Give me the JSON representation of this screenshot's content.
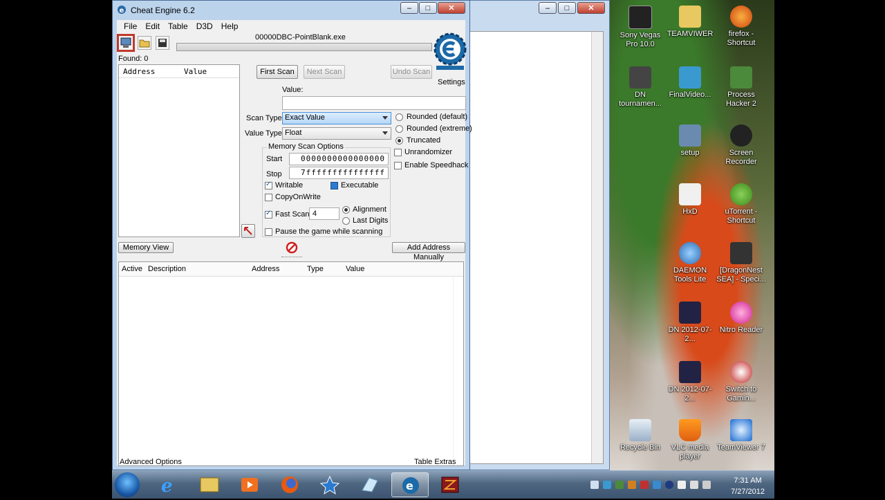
{
  "window": {
    "title": "Cheat Engine 6.2",
    "controls": {
      "minimize": "–",
      "maximize": "□",
      "close": "✕"
    }
  },
  "menu": [
    "File",
    "Edit",
    "Table",
    "D3D",
    "Help"
  ],
  "process": "00000DBC-PointBlank.exe",
  "found": "Found: 0",
  "settings": "Settings",
  "address_list": {
    "columns": [
      "Address",
      "Value"
    ]
  },
  "scan": {
    "first_scan": "First Scan",
    "next_scan": "Next Scan",
    "undo_scan": "Undo Scan",
    "value_label": "Value:",
    "value": "",
    "scan_type_label": "Scan Type",
    "scan_type": "Exact Value",
    "value_type_label": "Value Type",
    "value_type": "Float"
  },
  "rounding": {
    "rounded_default": "Rounded (default)",
    "rounded_extreme": "Rounded (extreme)",
    "truncated": "Truncated",
    "selected": "truncated"
  },
  "options": {
    "unrandomizer": "Unrandomizer",
    "enable_speedhack": "Enable Speedhack"
  },
  "memory_scan": {
    "title": "Memory Scan Options",
    "start_label": "Start",
    "start": "0000000000000000",
    "stop_label": "Stop",
    "stop": "7fffffffffffffff",
    "writable": "Writable",
    "executable": "Executable",
    "copy_on_write": "CopyOnWrite",
    "fast_scan": "Fast Scan",
    "fast_scan_value": "4",
    "alignment": "Alignment",
    "last_digits": "Last Digits",
    "pause": "Pause the game while scanning"
  },
  "buttons": {
    "memory_view": "Memory View",
    "add_address": "Add Address Manually"
  },
  "cheat_table": {
    "columns": [
      "Active",
      "Description",
      "Address",
      "Type",
      "Value"
    ]
  },
  "footer": {
    "advanced": "Advanced Options",
    "extras": "Table Extras"
  },
  "desktop_icons": [
    {
      "label": "Sony Vegas Pro 10.0"
    },
    {
      "label": "TEAMVIWER"
    },
    {
      "label": "firefox - Shortcut"
    },
    {
      "label": "DN tournamen..."
    },
    {
      "label": "FinalVideo..."
    },
    {
      "label": "Process Hacker 2"
    },
    {
      "label": "setup"
    },
    {
      "label": "Screen Recorder"
    },
    {
      "label": "HxD"
    },
    {
      "label": "uTorrent - Shortcut"
    },
    {
      "label": "DAEMON Tools Lite"
    },
    {
      "label": "[DragonNest SEA] - Speci..."
    },
    {
      "label": "DN 2012-07-2..."
    },
    {
      "label": "Nitro Reader"
    },
    {
      "label": "DN 2012-07-2..."
    },
    {
      "label": "Switch to Gamin..."
    },
    {
      "label": "Recycle Bin"
    },
    {
      "label": "VLC media player"
    },
    {
      "label": "TeamViewer 7"
    }
  ],
  "clock": {
    "time": "7:31 AM",
    "date": "7/27/2012"
  },
  "colors": {
    "accent": "#c0392b",
    "title": "#bcd3ec",
    "taskbar": "#4e6680"
  }
}
